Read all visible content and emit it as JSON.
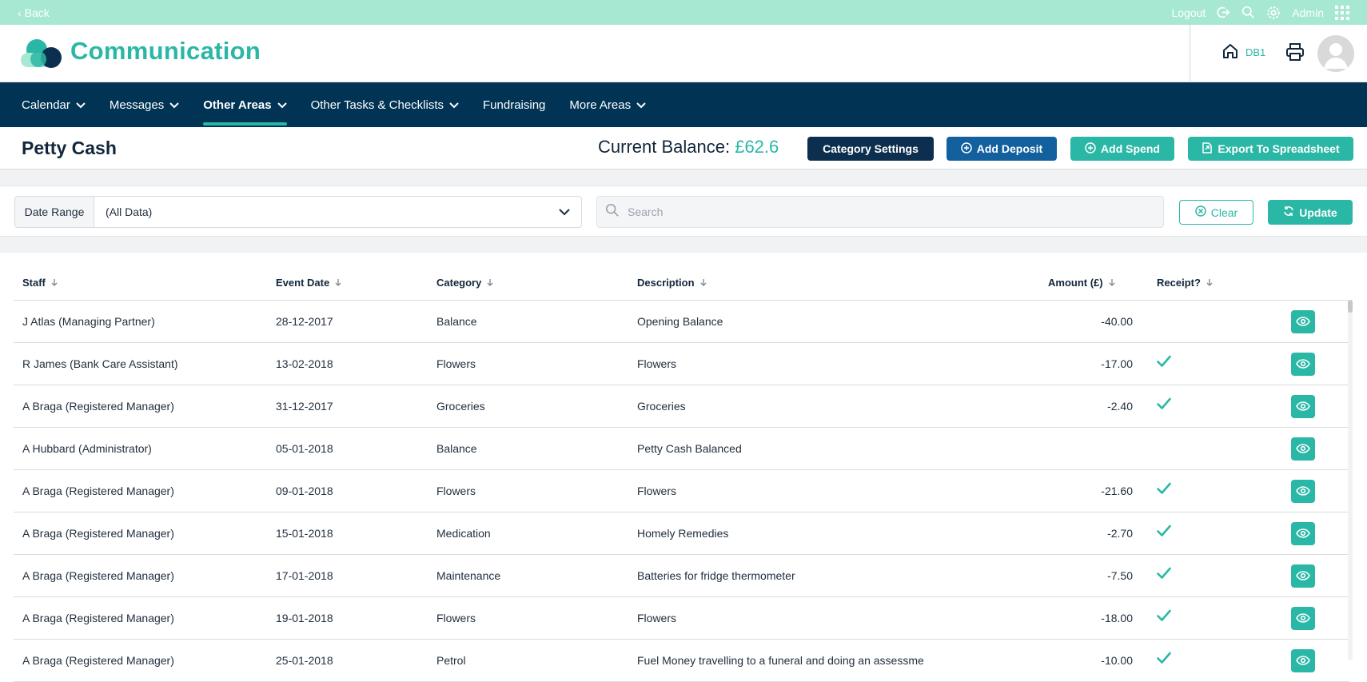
{
  "topbar": {
    "back_label": "Back",
    "logout_label": "Logout",
    "user_label": "Admin"
  },
  "header": {
    "app_title": "Communication",
    "location_code": "DB1"
  },
  "nav": {
    "items": [
      {
        "label": "Calendar",
        "dropdown": true
      },
      {
        "label": "Messages",
        "dropdown": true
      },
      {
        "label": "Other Areas",
        "dropdown": true,
        "active": true
      },
      {
        "label": "Other Tasks & Checklists",
        "dropdown": true
      },
      {
        "label": "Fundraising",
        "dropdown": false
      },
      {
        "label": "More Areas",
        "dropdown": true
      }
    ]
  },
  "page": {
    "title": "Petty Cash",
    "balance_label": "Current Balance: ",
    "balance_value": "£62.6",
    "buttons": {
      "category_settings": "Category Settings",
      "add_deposit": "Add Deposit",
      "add_spend": "Add Spend",
      "export": "Export To Spreadsheet"
    }
  },
  "filters": {
    "date_range_label": "Date Range",
    "date_range_value": "(All Data)",
    "search_placeholder": "Search",
    "clear_label": "Clear",
    "update_label": "Update"
  },
  "table": {
    "columns": [
      "Staff",
      "Event Date",
      "Category",
      "Description",
      "Amount (£)",
      "Receipt?"
    ],
    "rows": [
      {
        "staff": "J Atlas (Managing Partner)",
        "date": "28-12-2017",
        "category": "Balance",
        "description": "Opening Balance",
        "amount": "-40.00",
        "receipt": false
      },
      {
        "staff": "R James (Bank Care Assistant)",
        "date": "13-02-2018",
        "category": "Flowers",
        "description": "Flowers",
        "amount": "-17.00",
        "receipt": true
      },
      {
        "staff": "A Braga (Registered Manager)",
        "date": "31-12-2017",
        "category": "Groceries",
        "description": "Groceries",
        "amount": "-2.40",
        "receipt": true
      },
      {
        "staff": "A Hubbard (Administrator)",
        "date": "05-01-2018",
        "category": "Balance",
        "description": "Petty Cash Balanced",
        "amount": "",
        "receipt": false
      },
      {
        "staff": "A Braga (Registered Manager)",
        "date": "09-01-2018",
        "category": "Flowers",
        "description": "Flowers",
        "amount": "-21.60",
        "receipt": true
      },
      {
        "staff": "A Braga (Registered Manager)",
        "date": "15-01-2018",
        "category": "Medication",
        "description": "Homely Remedies",
        "amount": "-2.70",
        "receipt": true
      },
      {
        "staff": "A Braga (Registered Manager)",
        "date": "17-01-2018",
        "category": "Maintenance",
        "description": "Batteries for fridge thermometer",
        "amount": "-7.50",
        "receipt": true
      },
      {
        "staff": "A Braga (Registered Manager)",
        "date": "19-01-2018",
        "category": "Flowers",
        "description": "Flowers",
        "amount": "-18.00",
        "receipt": true
      },
      {
        "staff": "A Braga (Registered Manager)",
        "date": "25-01-2018",
        "category": "Petrol",
        "description": "Fuel Money travelling to a funeral and doing an assessme",
        "amount": "-10.00",
        "receipt": true
      }
    ]
  },
  "colors": {
    "teal": "#2bb7a6",
    "navy": "#003354",
    "topbar": "#a6e8d2",
    "blue": "#13609f"
  }
}
